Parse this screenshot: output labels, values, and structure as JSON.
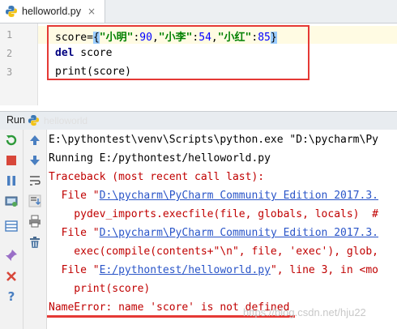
{
  "tab": {
    "filename": "helloworld.py",
    "close_glyph": "×"
  },
  "editor": {
    "line_numbers": [
      "1",
      "2",
      "3"
    ],
    "line1": {
      "var": "score=",
      "open": "{",
      "k1": "\"小明\"",
      "c1": ":",
      "v1": "90",
      "s1": ",",
      "k2": "\"小李\"",
      "c2": ":",
      "v2": "54",
      "s2": ",",
      "k3": "\"小红\"",
      "c3": ":",
      "v3": "85",
      "close": "}"
    },
    "line2": {
      "kw": "del",
      "rest": " score"
    },
    "line3": {
      "text": "print(score)"
    }
  },
  "run_panel": {
    "label": "Run",
    "config_name": "helloworld"
  },
  "console": {
    "lines": [
      {
        "text": "E:\\pythontest\\venv\\Scripts\\python.exe \"D:\\pycharm\\Py",
        "style": "black"
      },
      {
        "text": "Running E:/pythontest/helloworld.py",
        "style": "black"
      },
      {
        "text": "Traceback (most recent call last):",
        "style": "red"
      },
      {
        "prefix": "  File \"",
        "link": "D:\\pycharm\\PyCharm Community Edition 2017.3.",
        "suffix": ""
      },
      {
        "text": "    pydev_imports.execfile(file, globals, locals)  #",
        "style": "red"
      },
      {
        "prefix": "  File \"",
        "link": "D:\\pycharm\\PyCharm Community Edition 2017.3.",
        "suffix": ""
      },
      {
        "text": "    exec(compile(contents+\"\\n\", file, 'exec'), glob,",
        "style": "red"
      },
      {
        "prefix": "  File \"",
        "link": "E:/pythontest/helloworld.py",
        "suffix": "\", line 3, in <mo"
      },
      {
        "text": "    print(score)",
        "style": "red"
      },
      {
        "text": "NameError: name 'score' is not defined",
        "style": "red"
      }
    ]
  },
  "watermark": "https://blog.csdn.net/hju22",
  "colors": {
    "annotation_red": "#e53935",
    "error_red": "#c00000",
    "link_blue": "#2a55c8",
    "current_line": "#fffbe3"
  },
  "icons": {
    "toolbar_left": [
      "rerun-icon",
      "stop-icon",
      "pause-icon",
      "debug-config-icon",
      "layout-icon",
      "pin-icon",
      "close-icon",
      "help-icon"
    ],
    "toolbar_right": [
      "up-arrow-icon",
      "down-arrow-icon",
      "soft-wrap-icon",
      "scroll-to-end-icon",
      "print-icon",
      "trash-icon"
    ]
  }
}
